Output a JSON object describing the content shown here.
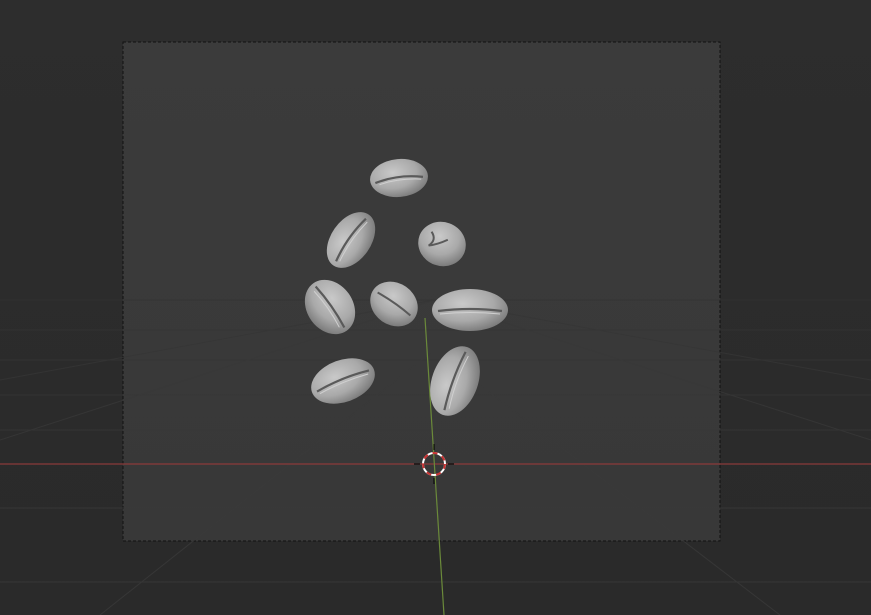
{
  "viewport": {
    "type": "3d-viewport",
    "view": "camera",
    "colors": {
      "background": "#2b2b2b",
      "camera_frame_fill": "#3a3a3a",
      "grid_line": "#333333",
      "x_axis": "#8a3a3a",
      "y_axis": "#6b8a3a",
      "object_base": "#a8a8a8",
      "object_highlight": "#c4c4c4",
      "object_shadow": "#6e6e6e",
      "cursor_red": "#c83232",
      "cursor_white": "#ffffff"
    },
    "scene_objects": [
      {
        "name": "coffee-bean-1",
        "shape": "bean"
      },
      {
        "name": "coffee-bean-2",
        "shape": "bean"
      },
      {
        "name": "coffee-bean-3",
        "shape": "bean-chipped"
      },
      {
        "name": "coffee-bean-4",
        "shape": "bean"
      },
      {
        "name": "coffee-bean-5",
        "shape": "bean"
      },
      {
        "name": "coffee-bean-6",
        "shape": "bean"
      },
      {
        "name": "coffee-bean-7",
        "shape": "bean"
      },
      {
        "name": "coffee-bean-8",
        "shape": "bean"
      }
    ],
    "overlay_elements": [
      "camera-frame",
      "floor-grid",
      "x-axis-line",
      "y-axis-line",
      "3d-cursor-icon"
    ]
  }
}
